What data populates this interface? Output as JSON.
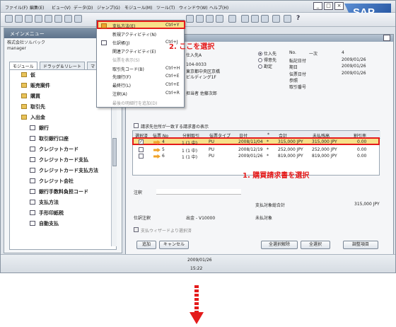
{
  "menubar": {
    "items": [
      "ファイル(F)",
      "編集(E)",
      "ビュー(V)",
      "データ(D)",
      "ジャンプ(G)",
      "モジュール(M)",
      "ツール(T)",
      "ウィンドウ(W)",
      "ヘルプ(H)"
    ]
  },
  "sap_logo": "SAP",
  "toolbar": {
    "help_glyph": "?"
  },
  "main_menu": {
    "title": "メインメニュー",
    "company": "株式会社ソルバック",
    "user": "manager",
    "tabs": [
      "モジュール",
      "ドラッグ＆リレート",
      "マ"
    ],
    "tree": [
      {
        "label": "仮",
        "type": "folder"
      },
      {
        "label": "販売案件",
        "type": "folder"
      },
      {
        "label": "購買",
        "type": "folder"
      },
      {
        "label": "取引先",
        "type": "folder"
      },
      {
        "label": "入出金",
        "type": "folder"
      },
      {
        "label": "銀行",
        "type": "doc"
      },
      {
        "label": "取引銀行口座",
        "type": "doc"
      },
      {
        "label": "クレジットカード",
        "type": "doc"
      },
      {
        "label": "クレジットカード支払",
        "type": "doc"
      },
      {
        "label": "クレジットカード支払方法",
        "type": "doc"
      },
      {
        "label": "クレジット会社",
        "type": "doc"
      },
      {
        "label": "銀行手数料負担コード",
        "type": "doc"
      },
      {
        "label": "支払方法",
        "type": "doc"
      },
      {
        "label": "手形印紙税",
        "type": "doc"
      },
      {
        "label": "自動支払",
        "type": "doc"
      }
    ]
  },
  "context_menu": {
    "items": [
      {
        "label": "支払方法(E)",
        "key": "Ctrl+Y",
        "disabled": false
      },
      {
        "label": "新規アクティビティ(N)",
        "key": "",
        "disabled": false
      },
      {
        "label": "仕訳帳(J)",
        "key": "Ctrl+J",
        "disabled": false
      },
      {
        "label": "関連アクティビティ(E)",
        "key": "",
        "disabled": false
      },
      {
        "label": "伝票を表示(S)",
        "key": "",
        "disabled": true
      },
      {
        "label": "取引先コード(B)",
        "key": "Ctrl+H",
        "disabled": false
      },
      {
        "label": "先頭行(F)",
        "key": "Ctrl+E",
        "disabled": false
      },
      {
        "label": "最終行(L)",
        "key": "Ctrl+E",
        "disabled": false
      },
      {
        "label": "注釈(A)",
        "key": "Ctrl+R",
        "disabled": false
      },
      {
        "label": "最後の明細行を追加(D)",
        "key": "",
        "disabled": true
      }
    ]
  },
  "annotations": {
    "step2": "2. ここを選択",
    "step1": "1. 購買請求書を選択"
  },
  "form": {
    "left_fields": [
      "仕入先A",
      "104-0033",
      "東京都中央区京橋",
      "ビルディング1F",
      "",
      "担当者 佐藤次郎"
    ],
    "radio_options": [
      "仕入先",
      "得意先",
      "勘定"
    ],
    "number_label": "No.",
    "number_series": "一次",
    "number_value": "4",
    "date_fields": [
      {
        "label": "転記日付",
        "value": "2009/01/26"
      },
      {
        "label": "期日",
        "value": "2009/01/26"
      },
      {
        "label": "伝票日付",
        "value": "2009/01/26"
      },
      {
        "label": "参照",
        "value": ""
      },
      {
        "label": "取引番号",
        "value": ""
      }
    ],
    "filter_label": "請求先住所が一致する請求書の表示",
    "grid_headers": [
      "選択済",
      "伝票 No",
      "分割取引",
      "伝票タイプ",
      "日付",
      "*",
      "合計",
      "未払残高",
      "割引率"
    ],
    "grid_rows": [
      {
        "checked": true,
        "doc": "4",
        "split": "1 (1 中)",
        "type": "PU",
        "date": "2008/11/04",
        "flag": "*",
        "total": "315,000 JPY",
        "balance": "315,000 JPY",
        "disc": "0.00"
      },
      {
        "checked": false,
        "doc": "5",
        "split": "1 (1 中)",
        "type": "PU",
        "date": "2008/12/19",
        "flag": "*",
        "total": "252,000 JPY",
        "balance": "252,000 JPY",
        "disc": "0.00"
      },
      {
        "checked": false,
        "doc": "6",
        "split": "1 (1 中)",
        "type": "PU",
        "date": "2009/01/26",
        "flag": "*",
        "total": "819,000 JPY",
        "balance": "819,000 JPY",
        "disc": "0.00"
      }
    ],
    "remarks_label": "注釈",
    "total_due_label": "支払対象総合計",
    "total_due_value": "315,000 JPY",
    "journal_label": "仕訳注釈",
    "journal_value": "出金 - V10000",
    "unpaid_label": "未払対象",
    "wizard_label": "支払ウィザードより選択済",
    "buttons": {
      "add": "追加",
      "cancel": "キャンセル",
      "select_all": "全選択解除",
      "all": "全選択",
      "reconcile": "調整項目"
    }
  },
  "status": {
    "date": "2009/01/26",
    "time": "15:22"
  },
  "colors": {
    "highlight": "#f7e089",
    "annotation": "#e41b1b"
  }
}
